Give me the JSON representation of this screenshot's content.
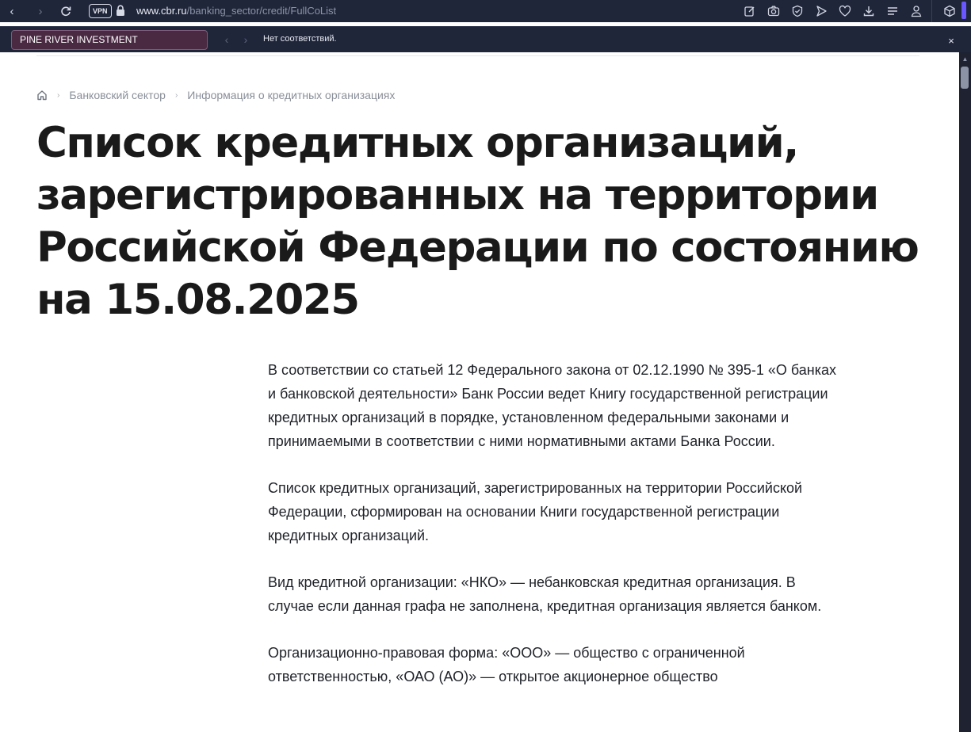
{
  "browser": {
    "vpn_label": "VPN",
    "url_domain": "www.cbr.ru",
    "url_path": "/banking_sector/credit/FullCoList"
  },
  "find_bar": {
    "query": "PINE RIVER INVESTMENT",
    "status": "Нет соответствий.",
    "close_glyph": "×"
  },
  "breadcrumb": {
    "items": [
      "Банковский сектор",
      "Информация о кредитных организациях"
    ]
  },
  "page": {
    "title": "Список кредитных организаций, зарегистрированных на территории Российской Федерации по состоянию на 15.08.2025",
    "paragraphs": [
      "В соответствии со статьей 12 Федерального закона от 02.12.1990 № 395-1 «О банках и банковской деятельности» Банк России ведет Книгу государственной регистрации кредитных организаций в порядке, установленном федеральными законами и принимаемыми в соответствии с ними нормативными актами Банка России.",
      "Список кредитных организаций, зарегистрированных на территории Российской Федерации, сформирован на основании Книги государственной регистрации кредитных организаций.",
      "Вид кредитной организации: «НКО» — небанковская кредитная организация. В случае если данная графа не заполнена, кредитная организация является банком.",
      "Организационно-правовая форма: «ООО» — общество с ограниченной ответственностью, «ОАО (АО)» — открытое акционерное общество"
    ]
  },
  "colors": {
    "chrome_bg": "#20263a",
    "find_input_bg": "#4a2a43",
    "accent_strip": "#6b57ff",
    "title_text": "#1a1a1a",
    "breadcrumb_text": "#8a8f99"
  }
}
